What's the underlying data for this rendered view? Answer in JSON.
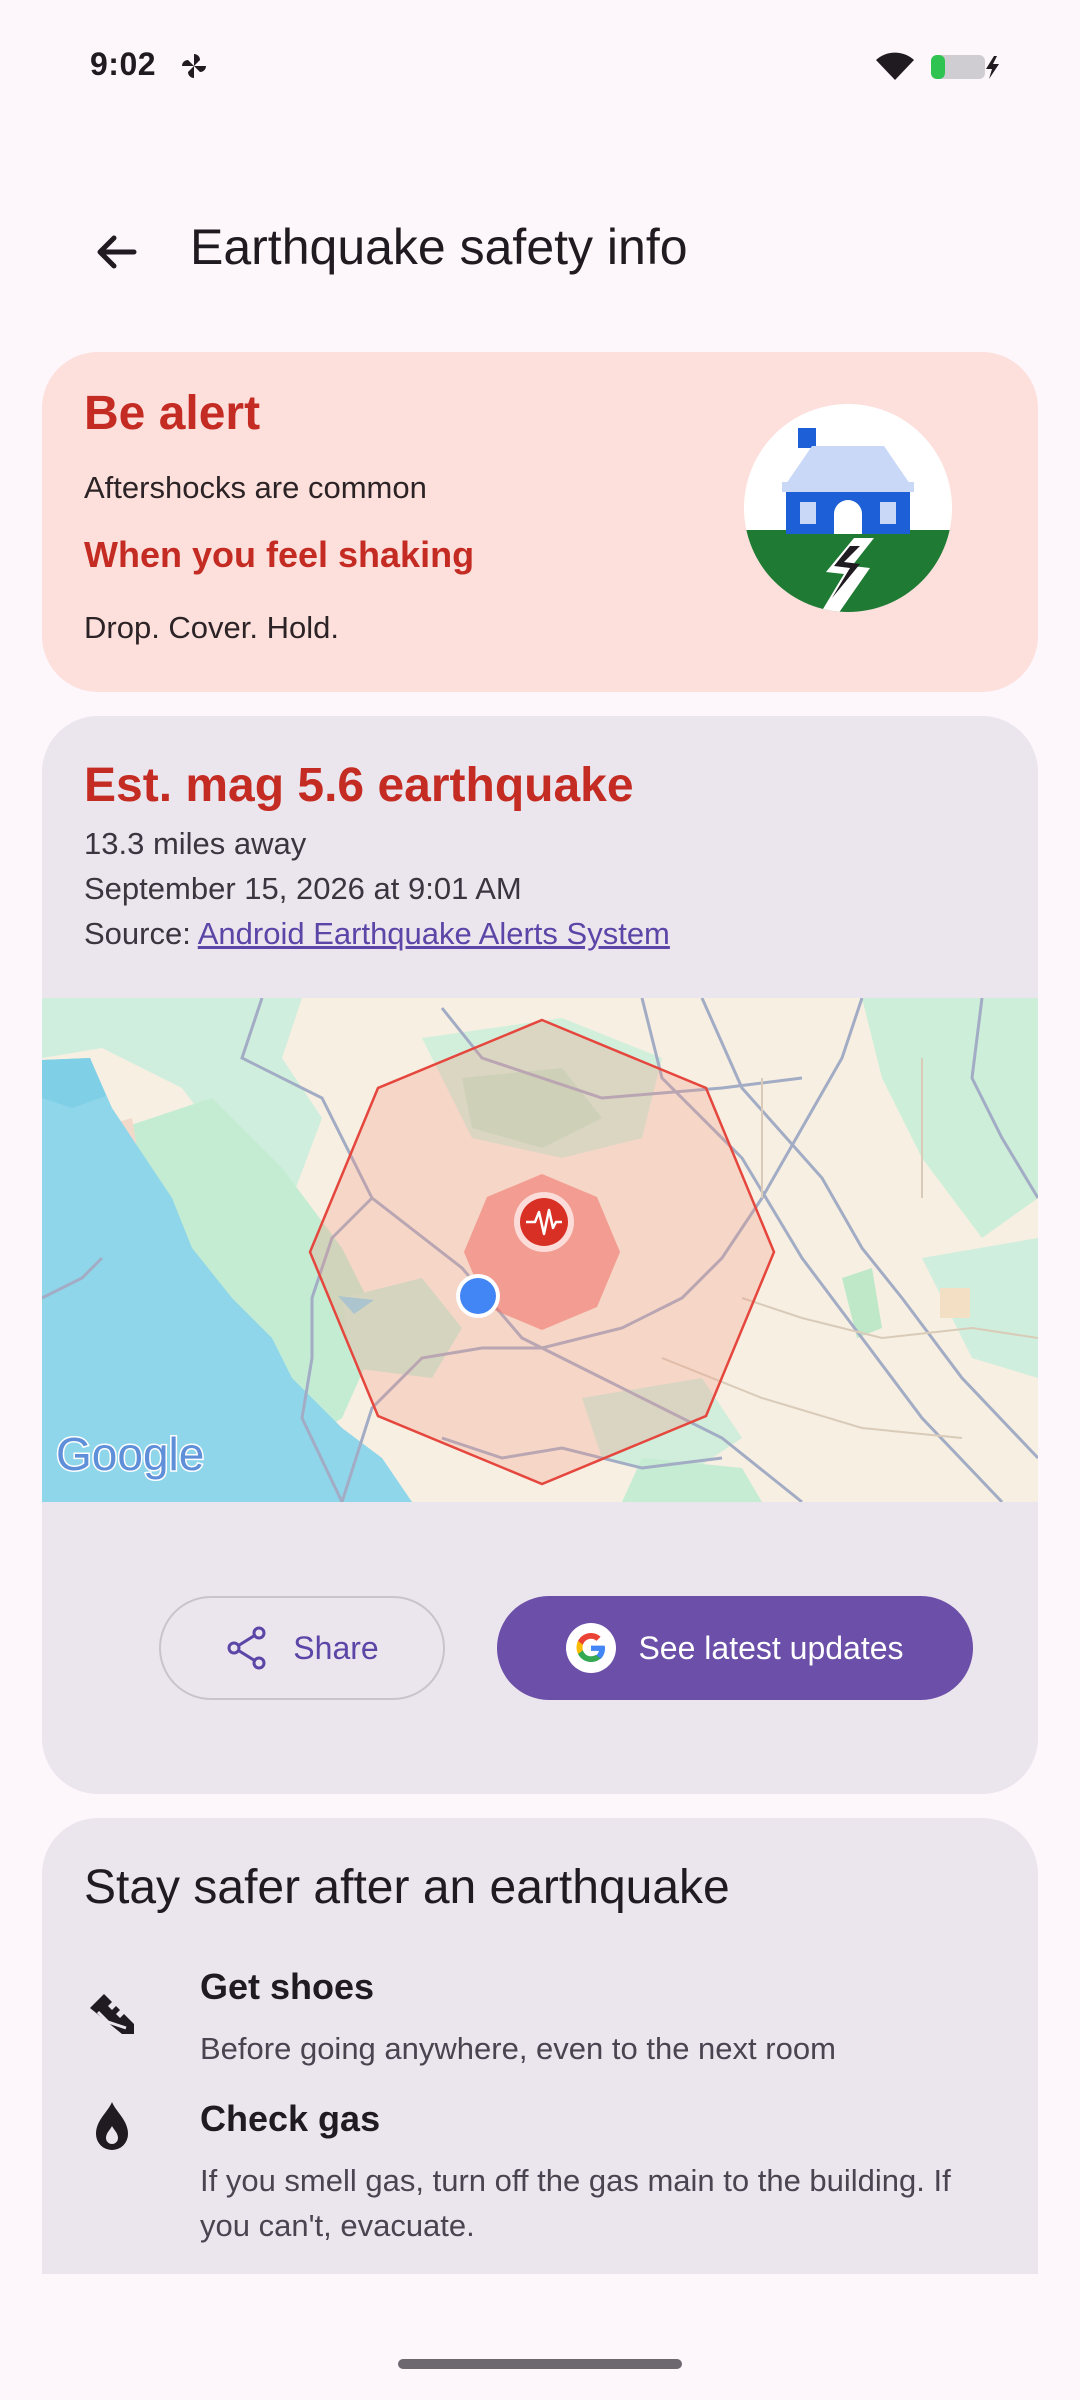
{
  "status_bar": {
    "time": "9:02",
    "notification_icon": "pinwheel-icon",
    "wifi_icon": "wifi-icon",
    "battery_icon": "battery-charging-icon"
  },
  "app_bar": {
    "back_icon": "arrow-back-icon",
    "title": "Earthquake safety info"
  },
  "alert_card": {
    "heading": "Be alert",
    "subtitle": "Aftershocks are common",
    "shaking_heading": "When you feel shaking",
    "instruction": "Drop. Cover. Hold.",
    "illustration": "house-earthquake-icon",
    "background_color": "#fde0dc",
    "accent_color": "#c42b22"
  },
  "quake_card": {
    "heading": "Est. mag 5.6 earthquake",
    "distance": "13.3 miles away",
    "datetime": "September 15, 2026 at 9:01 AM",
    "source_label": "Source: ",
    "source_link": "Android Earthquake Alerts System",
    "map": {
      "watermark": "Google",
      "epicenter_icon": "seismic-wave-icon",
      "user_location_icon": "user-location-dot"
    },
    "share_button": {
      "label": "Share",
      "icon": "share-icon"
    },
    "updates_button": {
      "label": "See latest updates",
      "icon": "google-g-icon",
      "color": "#6b4fa8"
    }
  },
  "safety_card": {
    "heading": "Stay safer after an earthquake",
    "items": [
      {
        "icon": "shoe-icon",
        "title": "Get shoes",
        "description": "Before going anywhere, even to the next room"
      },
      {
        "icon": "flame-icon",
        "title": "Check gas",
        "description": "If you smell gas, turn off the gas main to the building. If you can't, evacuate."
      }
    ]
  }
}
